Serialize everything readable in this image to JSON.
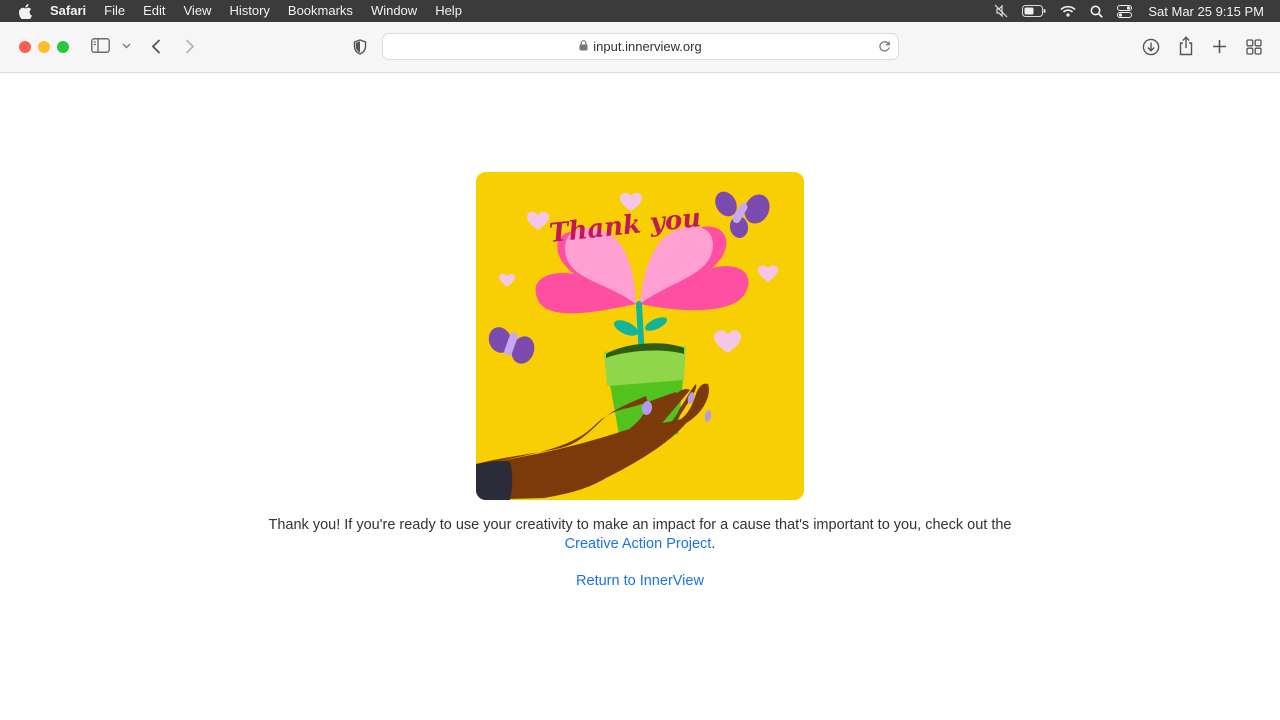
{
  "menubar": {
    "app_name": "Safari",
    "items": [
      "File",
      "Edit",
      "View",
      "History",
      "Bookmarks",
      "Window",
      "Help"
    ],
    "clock": "Sat Mar 25  9:15 PM"
  },
  "browser": {
    "url": "input.innerview.org"
  },
  "card": {
    "image_text": "Thank you",
    "accent_color": "#f8cf02"
  },
  "page": {
    "message_prefix": "Thank you! If you're ready to use your creativity to make an impact for a cause that's important to you, check out the ",
    "link_text": "Creative Action Project",
    "message_suffix": ".",
    "return_link": "Return to InnerView",
    "link_color": "#1a73e8"
  }
}
